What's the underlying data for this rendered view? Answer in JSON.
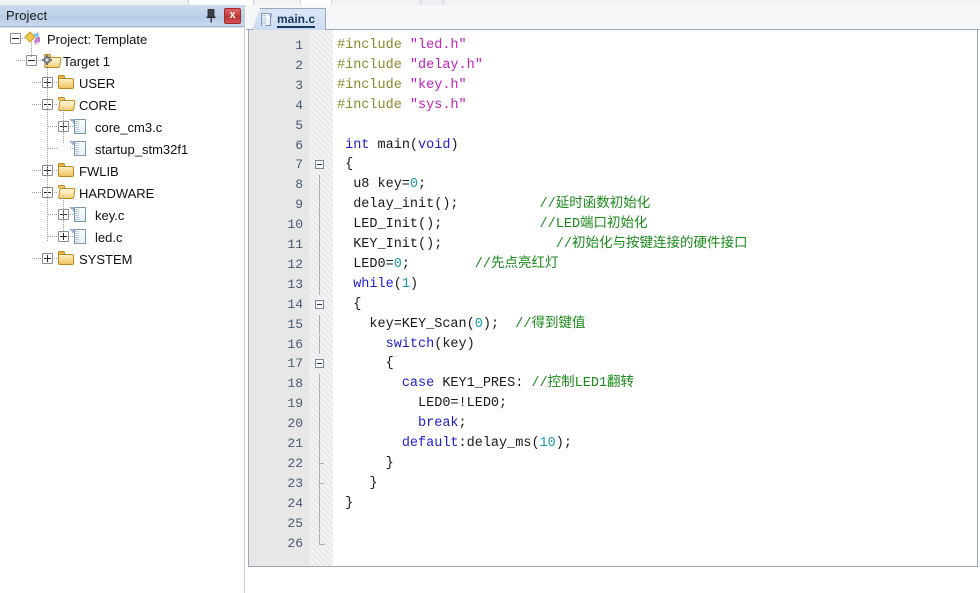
{
  "panel": {
    "title": "Project",
    "pin_icon": "pushpin-icon",
    "close_label": "x"
  },
  "tree": [
    {
      "label": "Project: Template",
      "icon": "project-icon",
      "depth": 0,
      "expander": "minus"
    },
    {
      "label": "Target 1",
      "icon": "target-icon",
      "depth": 1,
      "expander": "minus"
    },
    {
      "label": "USER",
      "icon": "folder-icon",
      "depth": 2,
      "expander": "plus"
    },
    {
      "label": "CORE",
      "icon": "folder-open-icon",
      "depth": 2,
      "expander": "minus"
    },
    {
      "label": "core_cm3.c",
      "icon": "file-icon",
      "depth": 3,
      "expander": "plus"
    },
    {
      "label": "startup_stm32f1",
      "icon": "file-icon",
      "depth": 3,
      "expander": "none"
    },
    {
      "label": "FWLIB",
      "icon": "folder-icon",
      "depth": 2,
      "expander": "plus"
    },
    {
      "label": "HARDWARE",
      "icon": "folder-open-icon",
      "depth": 2,
      "expander": "minus"
    },
    {
      "label": "key.c",
      "icon": "file-icon",
      "depth": 3,
      "expander": "plus"
    },
    {
      "label": "led.c",
      "icon": "file-icon",
      "depth": 3,
      "expander": "plus"
    },
    {
      "label": "SYSTEM",
      "icon": "folder-icon",
      "depth": 2,
      "expander": "plus"
    }
  ],
  "editor": {
    "tabs": [
      {
        "label": "main.c",
        "icon": "file-icon",
        "active": true
      }
    ],
    "lines": [
      {
        "n": "1",
        "fold": "none",
        "tokens": [
          {
            "t": "pre",
            "v": "#include "
          },
          {
            "t": "str",
            "v": "\"led.h\""
          }
        ]
      },
      {
        "n": "2",
        "fold": "none",
        "tokens": [
          {
            "t": "pre",
            "v": "#include "
          },
          {
            "t": "str",
            "v": "\"delay.h\""
          }
        ]
      },
      {
        "n": "3",
        "fold": "none",
        "tokens": [
          {
            "t": "pre",
            "v": "#include "
          },
          {
            "t": "str",
            "v": "\"key.h\""
          }
        ]
      },
      {
        "n": "4",
        "fold": "none",
        "tokens": [
          {
            "t": "pre",
            "v": "#include "
          },
          {
            "t": "str",
            "v": "\"sys.h\""
          }
        ]
      },
      {
        "n": "5",
        "fold": "none",
        "tokens": []
      },
      {
        "n": "6",
        "fold": "none",
        "tokens": [
          {
            "t": "plain",
            "v": " "
          },
          {
            "t": "kw",
            "v": "int"
          },
          {
            "t": "plain",
            "v": " main("
          },
          {
            "t": "kw",
            "v": "void"
          },
          {
            "t": "plain",
            "v": ")"
          }
        ]
      },
      {
        "n": "7",
        "fold": "start",
        "tokens": [
          {
            "t": "plain",
            "v": " {"
          }
        ]
      },
      {
        "n": "8",
        "fold": "bar",
        "tokens": [
          {
            "t": "plain",
            "v": "  u8 key="
          },
          {
            "t": "num",
            "v": "0"
          },
          {
            "t": "plain",
            "v": ";"
          }
        ]
      },
      {
        "n": "9",
        "fold": "bar",
        "tokens": [
          {
            "t": "plain",
            "v": "  delay_init();          "
          },
          {
            "t": "cmt",
            "v": "//延时函数初始化"
          }
        ]
      },
      {
        "n": "10",
        "fold": "bar",
        "tokens": [
          {
            "t": "plain",
            "v": "  LED_Init();            "
          },
          {
            "t": "cmt",
            "v": "//LED端口初始化"
          }
        ]
      },
      {
        "n": "11",
        "fold": "bar",
        "tokens": [
          {
            "t": "plain",
            "v": "  KEY_Init();              "
          },
          {
            "t": "cmt",
            "v": "//初始化与按键连接的硬件接口"
          }
        ]
      },
      {
        "n": "12",
        "fold": "bar",
        "tokens": [
          {
            "t": "plain",
            "v": "  LED0="
          },
          {
            "t": "num",
            "v": "0"
          },
          {
            "t": "plain",
            "v": ";        "
          },
          {
            "t": "cmt",
            "v": "//先点亮红灯"
          }
        ]
      },
      {
        "n": "13",
        "fold": "bar",
        "tokens": [
          {
            "t": "plain",
            "v": "  "
          },
          {
            "t": "kw",
            "v": "while"
          },
          {
            "t": "plain",
            "v": "("
          },
          {
            "t": "num",
            "v": "1"
          },
          {
            "t": "plain",
            "v": ")"
          }
        ]
      },
      {
        "n": "14",
        "fold": "start",
        "tokens": [
          {
            "t": "plain",
            "v": "  {"
          }
        ]
      },
      {
        "n": "15",
        "fold": "bar",
        "tokens": [
          {
            "t": "plain",
            "v": "    key=KEY_Scan("
          },
          {
            "t": "num",
            "v": "0"
          },
          {
            "t": "plain",
            "v": ");  "
          },
          {
            "t": "cmt",
            "v": "//得到键值"
          }
        ]
      },
      {
        "n": "16",
        "fold": "bar",
        "tokens": [
          {
            "t": "plain",
            "v": "      "
          },
          {
            "t": "kw",
            "v": "switch"
          },
          {
            "t": "plain",
            "v": "(key)"
          }
        ]
      },
      {
        "n": "17",
        "fold": "start",
        "tokens": [
          {
            "t": "plain",
            "v": "      {"
          }
        ]
      },
      {
        "n": "18",
        "fold": "bar",
        "tokens": [
          {
            "t": "plain",
            "v": "        "
          },
          {
            "t": "kw",
            "v": "case"
          },
          {
            "t": "plain",
            "v": " KEY1_PRES: "
          },
          {
            "t": "cmt",
            "v": "//控制LED1翻转"
          }
        ]
      },
      {
        "n": "19",
        "fold": "bar",
        "tokens": [
          {
            "t": "plain",
            "v": "          LED0=!LED0;"
          }
        ]
      },
      {
        "n": "20",
        "fold": "bar",
        "tokens": [
          {
            "t": "plain",
            "v": "          "
          },
          {
            "t": "kw",
            "v": "break"
          },
          {
            "t": "plain",
            "v": ";"
          }
        ]
      },
      {
        "n": "21",
        "fold": "bar",
        "tokens": [
          {
            "t": "plain",
            "v": "        "
          },
          {
            "t": "kw",
            "v": "default"
          },
          {
            "t": "plain",
            "v": ":delay_ms("
          },
          {
            "t": "num",
            "v": "10"
          },
          {
            "t": "plain",
            "v": ");"
          }
        ]
      },
      {
        "n": "22",
        "fold": "tick",
        "tokens": [
          {
            "t": "plain",
            "v": "      }"
          }
        ]
      },
      {
        "n": "23",
        "fold": "tick",
        "tokens": [
          {
            "t": "plain",
            "v": "    }"
          }
        ]
      },
      {
        "n": "24",
        "fold": "bar",
        "tokens": [
          {
            "t": "plain",
            "v": " }"
          }
        ]
      },
      {
        "n": "25",
        "fold": "bar",
        "tokens": []
      },
      {
        "n": "26",
        "fold": "end",
        "tokens": []
      }
    ]
  }
}
